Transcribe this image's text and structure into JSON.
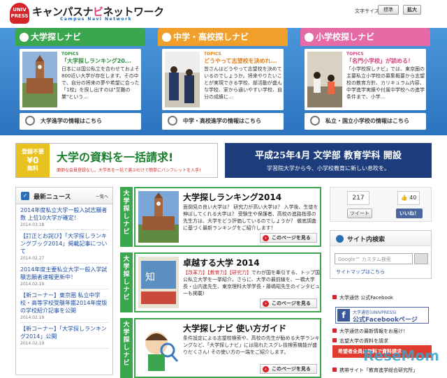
{
  "header": {
    "logo_badge": "UNIV PRESS",
    "logo_title_main": "キャンパスナ",
    "logo_title_pink": "ビ",
    "logo_title_tail": "ネットワーク",
    "logo_sub": "Campus Navi Network",
    "font_size_label": "文字サイズ",
    "font_std": "標準",
    "font_big": "拡大"
  },
  "nav": [
    {
      "tab": "大学探しナビ",
      "topics": "TOPICS",
      "title": "「大学探しランキング20...",
      "desc": "日本には国公私立を合わせておよそ800近い大学が存在します。その中で、自分の将来の夢や希望に合った「1校」を探し出すのは\"至難の業\"という...",
      "more": "大学進学の情報はこちら"
    },
    {
      "tab": "中学・高校探しナビ",
      "topics": "TOPICS",
      "title": "どうやって志望校を決めれ...",
      "desc": "皆さんはどうやって志望校を決めているのでしょうか。将来やりたいことが実現できる学校、部活動が盛んな学校、家から通いやすい学校、自分の成績に...",
      "more": "中学・高校進学の情報はこちら"
    },
    {
      "tab": "小学校探しナビ",
      "topics": "TOPICS",
      "title": "「名門小学校」が読める！",
      "desc": "「小学校探しナビ」では、東京圏の主要私立小学校の募集概要から志望校の教育方針、カリキュラム内容、中学進学実績や付属中学校への進学条件まで、小学...",
      "more": "私立・国立小学校の情報はこちら"
    }
  ],
  "banner_left": {
    "yen_top": "登録不要",
    "yen_mid": "¥0",
    "yen_bot": "無料",
    "head": "大学の資料を一括請求!",
    "sub": "面倒な会員登録なし。大学名を一括で選ぶだけで簡単にパンフレットを入手!"
  },
  "banner_right": {
    "l1": "平成25年4月 文学部 教育学科 開設",
    "l2": "学習院大学から今、小学校教育に新しい息吹を。"
  },
  "news": {
    "title": "最新ニュース",
    "list_link": "一覧へ",
    "items": [
      {
        "text": "2014年度私立大学一般入試志願者数 上位10大学が確定！",
        "date": "2014.03.18"
      },
      {
        "text": "【訂正とお詫び】「大学探しランキングブック2014」掲載記事について",
        "date": "2014.02.27"
      },
      {
        "text": "2014年度主要私立大学一般入学試験志願者速報更新中！",
        "date": "2014.02.19"
      },
      {
        "text": "【新コーナー】東京圏 私立中学校・高等学校受験年鑑2014年度版の学校紹介記事を公開",
        "date": "2014.02.19"
      },
      {
        "text": "【新コーナー】「大学探しランキング2014」公開",
        "date": "2014.02.19"
      }
    ]
  },
  "articles": [
    {
      "tab": "大\n学\n探\nし\nナ\nビ",
      "title": "大学探しランキング2014",
      "pre": "",
      "desc": "面倒見の良い大学は？ 研究力が高い大学は？ 入学後、生徒を伸ばしてくれる大学は？ 受験生や保護者、高校の進路指導の先生方は、大学をどう評価しているのでしょうか？ 徹底調査に基づく最新ランキングをご紹介します！",
      "go": "このページを見る"
    },
    {
      "tab": "大\n学\n探\nし\nナ\nビ",
      "title": "卓越する大学 2014",
      "pre": "【改革力】【教育力】【研究力】",
      "desc": "でわが国を牽引する、トップ国公私立大学を一挙紹介。さらに、大学の最前線を、一橋大学長・山内進先生、東京理科大学学長・藤嶋昭先生のインタビューも掲載!",
      "go": "このページを見る"
    },
    {
      "tab": "大\n学\n探\nし\nナ\nビ",
      "title": "大学探しナビ 使い方ガイド",
      "pre": "",
      "desc": "条件設定による志望校検索や、高校の先生が勧める大学ランキングなど、「大学探しナビ」には隠れたスグレ技検索機能が盛りだくさん! その使い方の一端をご紹介します。",
      "go": "このページを見る"
    }
  ],
  "social": {
    "tw_count": "217",
    "fb_count": "40",
    "tw_btn": "ツイート",
    "fb_btn": "いいね！"
  },
  "search": {
    "title": "サイト内検索",
    "placeholder": "Google™ カスタム検索",
    "sitemap": "サイトマップはこちら"
  },
  "right_links": {
    "fb": "大学通信 公式Facebook",
    "fb_banner_sub": "大学通信(UNIVPRESS)",
    "fb_banner_title": "公式Facebookページ",
    "info": "大学通信の最新情報をお届け！",
    "book": "志望大学の資料を請求",
    "red": "希望者全員に無料で資料請求",
    "ext": "携帯サイト「教育進学総合研究所」"
  },
  "watermark": "ReseMom"
}
